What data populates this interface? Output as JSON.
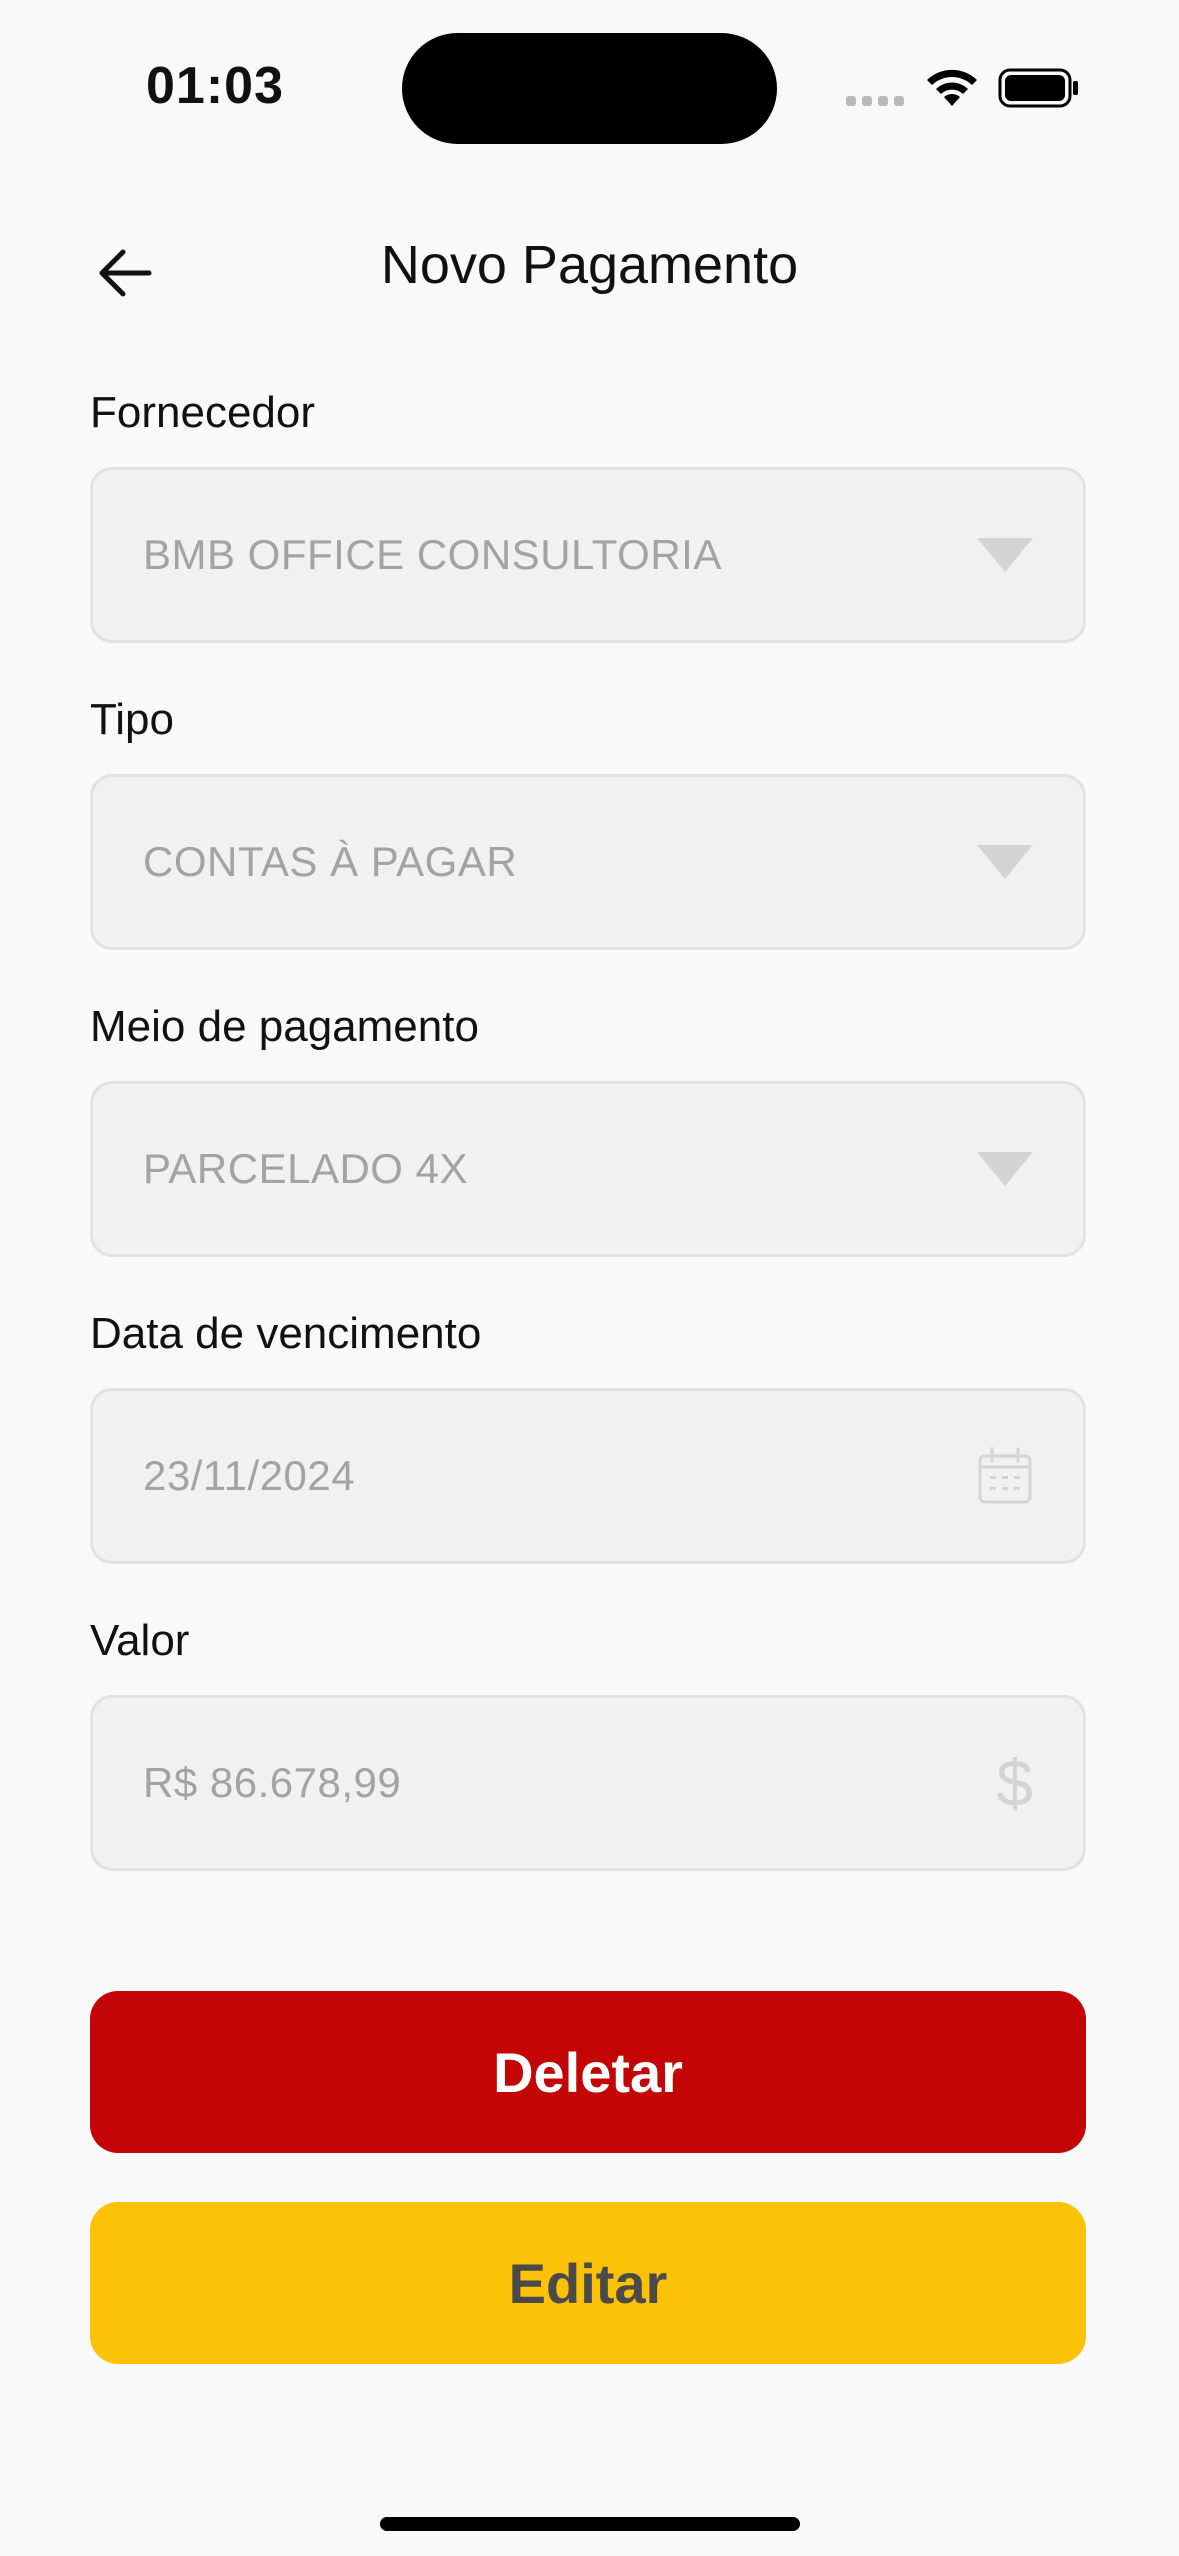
{
  "status_bar": {
    "time": "01:03"
  },
  "header": {
    "title": "Novo Pagamento"
  },
  "form": {
    "fornecedor": {
      "label": "Fornecedor",
      "value": "BMB OFFICE CONSULTORIA"
    },
    "tipo": {
      "label": "Tipo",
      "value": "CONTAS À PAGAR"
    },
    "meio_pagamento": {
      "label": "Meio de pagamento",
      "value": "PARCELADO 4X"
    },
    "data_vencimento": {
      "label": "Data de vencimento",
      "value": "23/11/2024"
    },
    "valor": {
      "label": "Valor",
      "value": "R$ 86.678,99",
      "icon_glyph": "$"
    }
  },
  "actions": {
    "delete_label": "Deletar",
    "edit_label": "Editar"
  },
  "icons": {
    "back": "arrow-left-icon",
    "dropdown": "caret-down-icon",
    "calendar": "calendar-icon",
    "currency": "dollar-icon"
  },
  "colors": {
    "delete": "#c40506",
    "edit": "#fbc207",
    "field_bg": "#f1f1f1",
    "placeholder_text": "#a3a3a3"
  }
}
